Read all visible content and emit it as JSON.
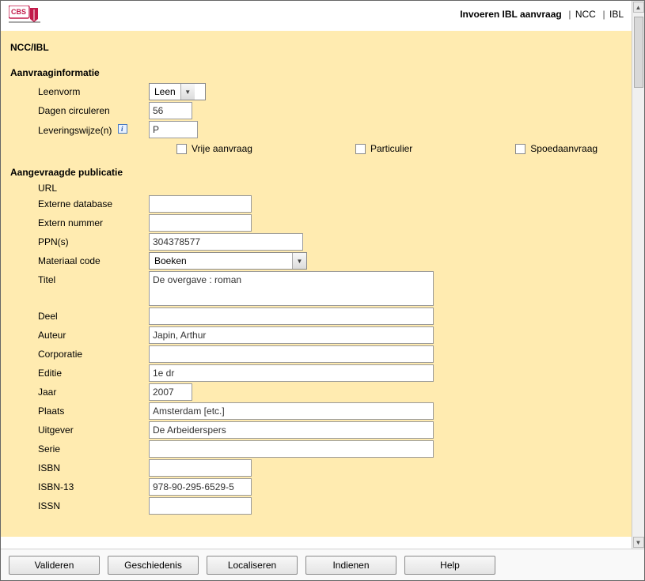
{
  "header": {
    "breadcrumb_active": "Invoeren IBL aanvraag",
    "breadcrumb_items": [
      "NCC",
      "IBL"
    ]
  },
  "panel_title": "NCC/IBL",
  "sections": {
    "aanvraag": {
      "title": "Aanvraaginformatie",
      "labels": {
        "leenvorm": "Leenvorm",
        "dagen_circuleren": "Dagen circuleren",
        "leveringswijze": "Leveringswijze(n)"
      },
      "values": {
        "leenvorm": "Leen",
        "dagen_circuleren": "56",
        "leveringswijze": "P"
      },
      "checkboxes": {
        "vrije_aanvraag": "Vrije aanvraag",
        "particulier": "Particulier",
        "spoedaanvraag": "Spoedaanvraag"
      }
    },
    "publicatie": {
      "title": "Aangevraagde publicatie",
      "labels": {
        "url": "URL",
        "externe_database": "Externe database",
        "extern_nummer": "Extern nummer",
        "ppns": "PPN(s)",
        "materiaal_code": "Materiaal code",
        "titel": "Titel",
        "deel": "Deel",
        "auteur": "Auteur",
        "corporatie": "Corporatie",
        "editie": "Editie",
        "jaar": "Jaar",
        "plaats": "Plaats",
        "uitgever": "Uitgever",
        "serie": "Serie",
        "isbn": "ISBN",
        "isbn13": "ISBN-13",
        "issn": "ISSN"
      },
      "values": {
        "url": "",
        "externe_database": "",
        "extern_nummer": "",
        "ppns": "304378577",
        "materiaal_code": "Boeken",
        "titel": "De overgave : roman",
        "deel": "",
        "auteur": "Japin, Arthur",
        "corporatie": "",
        "editie": "1e dr",
        "jaar": "2007",
        "plaats": "Amsterdam [etc.]",
        "uitgever": "De Arbeiderspers",
        "serie": "",
        "isbn": "",
        "isbn13": "978-90-295-6529-5",
        "issn": ""
      }
    }
  },
  "buttons": {
    "valideren": "Valideren",
    "geschiedenis": "Geschiedenis",
    "localiseren": "Localiseren",
    "indienen": "Indienen",
    "help": "Help"
  }
}
